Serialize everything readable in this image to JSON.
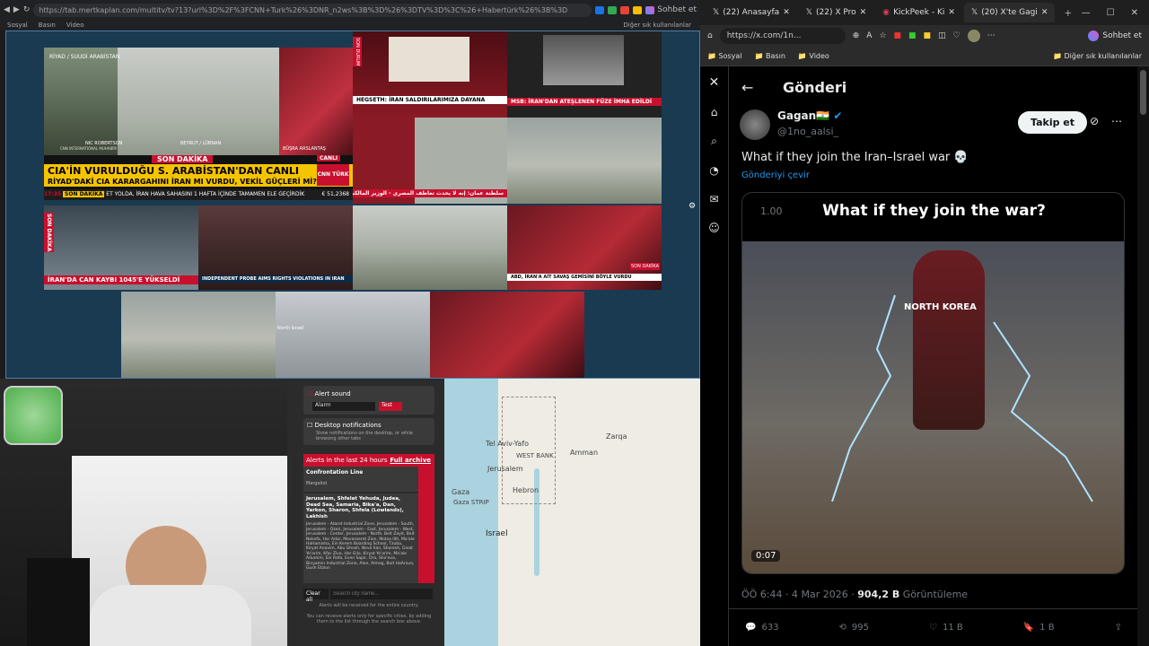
{
  "left_browser": {
    "url": "https://tab.mertkaplan.com/multitv/tv?13?url%3D%2F%3FCNN+Turk%26%3DNR_n2ws%3B%3D%26%3DTV%3D%3C%26+Habertürk%26%3B%3D",
    "bookmarks": [
      "Sosyal",
      "Basın",
      "Video"
    ],
    "extra_tab": "Sohbet et",
    "others": "Diğer sık kullanılanlar"
  },
  "news": {
    "cnn_location": "RİYAD / SUUDİ ARABİSTAN",
    "cnn_reporter": "NIC ROBERTSON",
    "cnn_reporter_sub": "CNN INTERNATIONAL MUHABİRİ",
    "cnn_loc2": "BEYRUT / LÜBNAN",
    "cnn_anchor": "BÜŞRA ARSLANTAŞ",
    "live": "CANLI",
    "cnn_flag": "SON DAKİKA",
    "cnn_headline1": "CIA'İN VURULDUĞU S. ARABİSTAN'DAN CANLI",
    "cnn_headline2": "RİYAD'DAKİ CIA KARARGAHINI İRAN MI VURDU, VEKİL GÜÇLERİ Mİ?",
    "cnn_ticker_label": "SON DAKİKA",
    "cnn_ticker": "ET YOLDA, İRAN HAVA SAHASINI 1 HAFTA İÇİNDE TAMAMEN ELE GEÇİRDİK",
    "cnn_time": "17:35",
    "cnn_price": "€ 51,2368",
    "cnn_logo": "CNN TÜRK",
    "ntv_tag": "SON DURUM",
    "ntv_headline": "HEGSETH: İRAN SALDIRILARIMIZA DAYANA",
    "msb_headline": "MSB: İRAN'DAN ATEŞLENEN FÜZE İMHA EDİLDİ",
    "arab_ticker": "سلطنة عمان: إنه لا يحدث تعاطف المصري - الوزير المالكي",
    "iran_flag": "SON DAKİKA",
    "iran_headline": "İRAN'DA CAN KAYBI 1045'E YÜKSELDİ",
    "probe_headline": "INDEPENDENT PROBE AIMS RIGHTS VIOLATIONS IN IRAN",
    "abd_headline": "ABD, İRAN'A AİT SAVAŞ GEMİSİNİ BÖYLE VURDU",
    "abd_tag": "SON DAKİKA",
    "north_israel": "North Israel"
  },
  "alerts_panel": {
    "alert_sound": "Alert sound",
    "sound_option": "Alarm",
    "test_btn": "Test",
    "desktop_notifications": "Desktop notifications",
    "desktop_desc": "Show notifications on the desktop, or while browsing other tabs",
    "last24": "Alerts in the last 24 hours",
    "full_archive": "Full archive",
    "alert1_title": "Confrontation Line",
    "alert1_sub": "Margaliot",
    "alert2_title": "Jerusalem, Shfelat Yehuda, Judea, Dead Sea, Samaria, Bika'a, Dan, Yarkon, Sharon, Shfela (Lowlands), Lakhish",
    "alert2_body": "Jerusalem - Atarot Industrial Zone, Jerusalem - South, Jerusalem - Ozeir, Jerusalem - East, Jerusalem - West, Jerusalem - Center, Jerusalem - North, Beit Zayit, Beit Nekofa, Har Adar, Mevasseret Zion, Motza Illit, Ma'ale HaHamisha, Ein Kerem Boarding School, Tzuba, Kiryat Anavim, Abu Ghosh, Neve Ilan, Shoresh, Givat Ye'arim, Kfar Ziva, Har Gilo, Kiryat Ye'arim, Ma'ale Adumim, Ein Rafa, Even Sapir, Ora, Sho'eva, Binyamin Industrial Zone, Alon, Almog, Beit HaArava, Gush Etzion",
    "clear_all": "Clear all",
    "search_placeholder": "Search city name...",
    "footer1": "Alerts will be received for the entire country.",
    "footer2": "You can receive alerts only for specific cities, by adding them to the list through the search box above."
  },
  "map": {
    "labels": [
      "Tel Aviv-Yafo",
      "WEST BANK",
      "Amman",
      "Jerusalem",
      "Gaza",
      "Gaza STRIP",
      "Hebron",
      "Israel",
      "Zarqa"
    ]
  },
  "right_browser": {
    "tabs": [
      "(22) Anasayfa",
      "(22) X Pro",
      "KickPeek - Ki",
      "(20) X'te Gagi"
    ],
    "url": "https://x.com/1n...",
    "copilot": "Sohbet et",
    "bookmarks": [
      "Sosyal",
      "Basın",
      "Video"
    ],
    "others": "Diğer sık kullanılanlar"
  },
  "post": {
    "header": "Gönderi",
    "display_name": "Gagan🇮🇳",
    "handle": "@1no_aalsi_",
    "follow_label": "Takip et",
    "text": "What if they join the Iran–Israel war 💀",
    "translate": "Gönderiyi çevir",
    "video_caption": "What if they join the war?",
    "video_speed": "1.00",
    "video_label": "NORTH KOREA",
    "video_time": "0:07",
    "meta_time": "ÖÖ 6:44 · 4 Mar 2026 · ",
    "views_value": "904,2 B",
    "views_label": " Görüntüleme",
    "replies": "633",
    "reposts": "995",
    "likes": "11 B",
    "bookmarks": "1 B"
  },
  "colors": {
    "x_blue": "#1d9bf0",
    "alert_red": "#c8102e",
    "cnn_yellow": "#f5c400"
  }
}
